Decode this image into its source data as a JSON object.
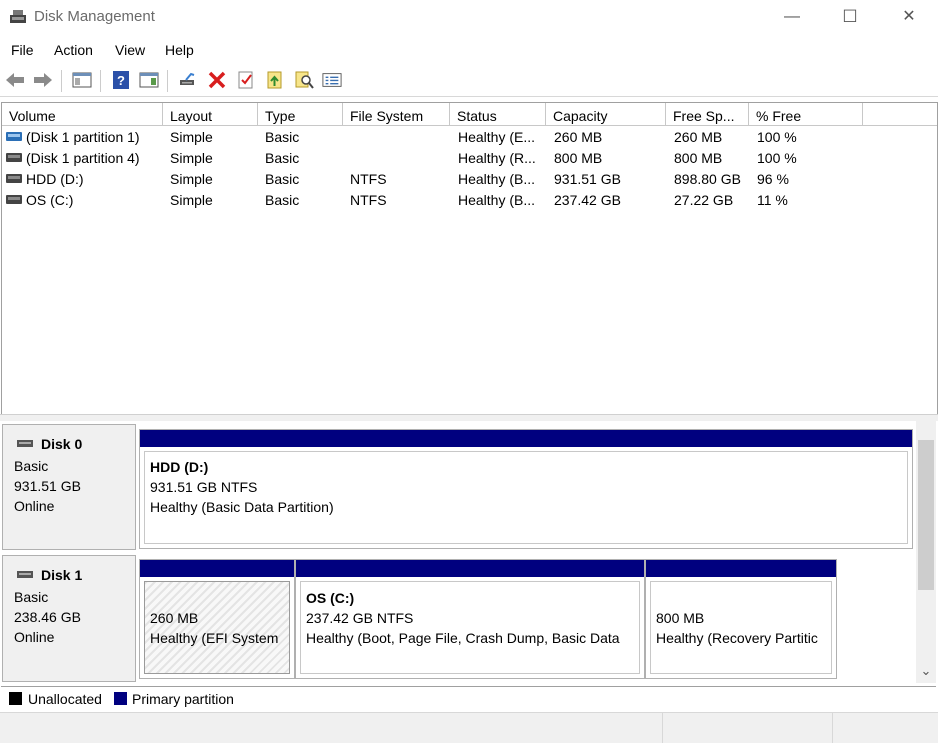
{
  "window": {
    "title": "Disk Management",
    "minimize": "—",
    "maximize": "☐",
    "close": "✕"
  },
  "menu": [
    "File",
    "Action",
    "View",
    "Help"
  ],
  "toolbar": {
    "icons": [
      "back-icon",
      "forward-icon",
      "console-tree-icon",
      "help-icon",
      "action-pane-icon",
      "connect-icon",
      "delete-icon",
      "properties-icon",
      "import-icon",
      "search-icon",
      "list-icon"
    ]
  },
  "volume_list": {
    "columns": [
      "Volume",
      "Layout",
      "Type",
      "File System",
      "Status",
      "Capacity",
      "Free Sp...",
      "% Free"
    ],
    "rows": [
      {
        "volume": "(Disk 1 partition 1)",
        "layout": "Simple",
        "type": "Basic",
        "fs": "",
        "status": "Healthy (E...",
        "capacity": "260 MB",
        "free": "260 MB",
        "pct": "100 %",
        "icon": "blue"
      },
      {
        "volume": "(Disk 1 partition 4)",
        "layout": "Simple",
        "type": "Basic",
        "fs": "",
        "status": "Healthy (R...",
        "capacity": "800 MB",
        "free": "800 MB",
        "pct": "100 %",
        "icon": "gray"
      },
      {
        "volume": "HDD (D:)",
        "layout": "Simple",
        "type": "Basic",
        "fs": "NTFS",
        "status": "Healthy (B...",
        "capacity": "931.51 GB",
        "free": "898.80 GB",
        "pct": "96 %",
        "icon": "gray"
      },
      {
        "volume": "OS (C:)",
        "layout": "Simple",
        "type": "Basic",
        "fs": "NTFS",
        "status": "Healthy (B...",
        "capacity": "237.42 GB",
        "free": "27.22 GB",
        "pct": "11 %",
        "icon": "gray"
      }
    ]
  },
  "disks": [
    {
      "name": "Disk 0",
      "type": "Basic",
      "size": "931.51 GB",
      "state": "Online",
      "partitions": [
        {
          "title": "HDD  (D:)",
          "line1": "931.51 GB NTFS",
          "line2": "Healthy (Basic Data Partition)"
        }
      ]
    },
    {
      "name": "Disk 1",
      "type": "Basic",
      "size": "238.46 GB",
      "state": "Online",
      "partitions": [
        {
          "title": "",
          "line1": "260 MB",
          "line2": "Healthy (EFI System"
        },
        {
          "title": "OS  (C:)",
          "line1": "237.42 GB NTFS",
          "line2": "Healthy (Boot, Page File, Crash Dump, Basic Data"
        },
        {
          "title": "",
          "line1": "800 MB",
          "line2": "Healthy (Recovery Partitic"
        }
      ]
    }
  ],
  "legend": {
    "unallocated": "Unallocated",
    "primary": "Primary partition",
    "unallocated_color": "#000000",
    "primary_color": "#00007f"
  },
  "scroll": {
    "down_arrow": "⌄"
  }
}
